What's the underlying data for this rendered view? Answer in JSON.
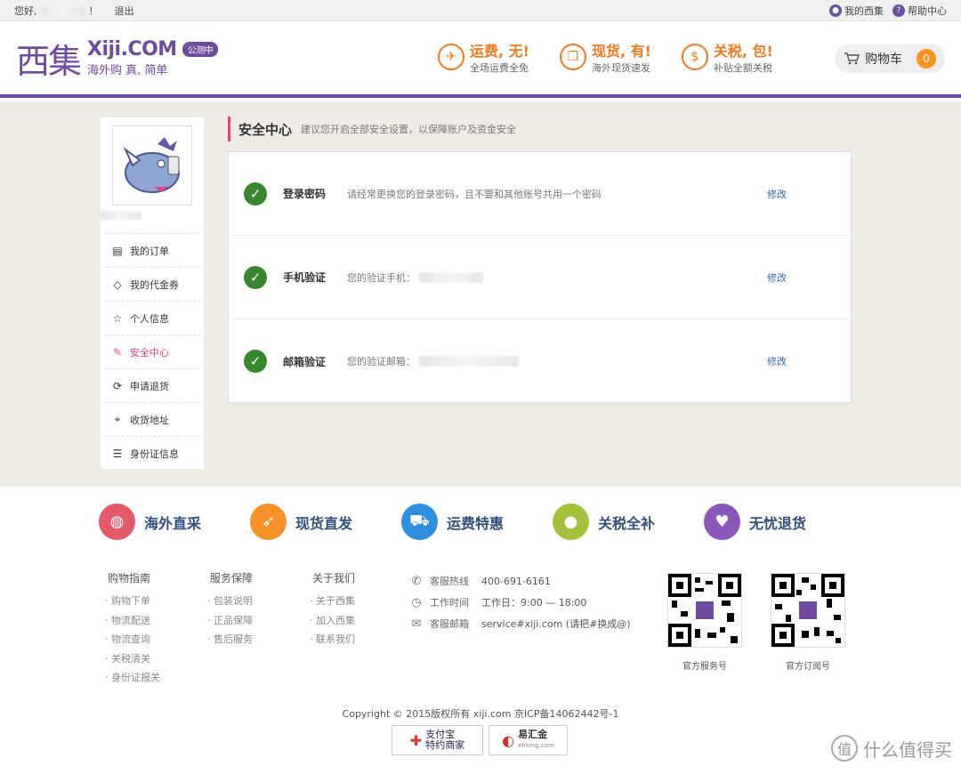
{
  "topbar": {
    "greeting": "您好,",
    "exclaim": "！",
    "logout": "退出",
    "my_xiji": "我的西集",
    "help": "帮助中心"
  },
  "header": {
    "logo_cn": "西集",
    "logo_en": "Xiji.COM",
    "badge": "公测中",
    "slogan": "海外购 真, 简单",
    "promos": [
      {
        "icon": "plane-icon",
        "title": "运费, 无!",
        "sub": "全场运费全免"
      },
      {
        "icon": "gift-icon",
        "title": "现货, 有!",
        "sub": "海外现货速发"
      },
      {
        "icon": "coin-icon",
        "title": "关税, 包!",
        "sub": "补贴全额关税"
      }
    ],
    "cart": {
      "label": "购物车",
      "count": "0"
    }
  },
  "sidebar": {
    "items": [
      {
        "label": "我的订单",
        "icon": "order-icon"
      },
      {
        "label": "我的代金券",
        "icon": "tag-icon"
      },
      {
        "label": "个人信息",
        "icon": "star-icon"
      },
      {
        "label": "安全中心",
        "icon": "edit-icon",
        "active": true
      },
      {
        "label": "申请退货",
        "icon": "refresh-icon"
      },
      {
        "label": "收货地址",
        "icon": "location-icon"
      },
      {
        "label": "身份证信息",
        "icon": "id-icon"
      }
    ]
  },
  "security": {
    "title": "安全中心",
    "desc": "建议您开启全部安全设置，以保障账户及资金安全",
    "rows": [
      {
        "label": "登录密码",
        "desc": "请经常更换您的登录密码，且不要和其他账号共用一个密码",
        "action": "修改"
      },
      {
        "label": "手机验证",
        "desc": "您的验证手机：",
        "action": "修改"
      },
      {
        "label": "邮箱验证",
        "desc": "您的验证邮箱：",
        "action": "修改"
      }
    ]
  },
  "features": [
    {
      "label": "海外直采",
      "color": "#e35a6a",
      "icon": "bag-icon"
    },
    {
      "label": "现货直发",
      "color": "#f5932a",
      "icon": "rocket-icon"
    },
    {
      "label": "运费特惠",
      "color": "#2e8fe0",
      "icon": "truck-icon"
    },
    {
      "label": "关税全补",
      "color": "#a3c23a",
      "icon": "piggy-icon"
    },
    {
      "label": "无忧退货",
      "color": "#8a58b8",
      "icon": "heart-icon"
    }
  ],
  "footer": {
    "columns": [
      {
        "title": "购物指南",
        "links": [
          "· 购物下单",
          "· 物流配送",
          "· 物流查询",
          "· 关税清关",
          "· 身份证报关"
        ]
      },
      {
        "title": "服务保障",
        "links": [
          "· 包装说明",
          "· 正品保障",
          "· 售后服务"
        ]
      },
      {
        "title": "关于我们",
        "links": [
          "· 关于西集",
          "· 加入西集",
          "· 联系我们"
        ]
      }
    ],
    "contact": [
      {
        "label": "客服热线",
        "value": "400-691-6161",
        "icon": "phone-icon"
      },
      {
        "label": "工作时间",
        "value": "工作日：9:00 — 18:00",
        "icon": "clock-icon"
      },
      {
        "label": "客服邮箱",
        "value": "service#xiji.com (请把#换成@)",
        "icon": "mail-icon"
      }
    ],
    "qr": [
      {
        "label": "官方服务号"
      },
      {
        "label": "官方订阅号"
      }
    ],
    "copyright": "Copyright © 2015版权所有 xiji.com 京ICP备14062442号-1",
    "badges": [
      {
        "line1": "支付宝",
        "line2": "特约商家"
      },
      {
        "label": "易汇金",
        "sub": "ehking.com"
      }
    ],
    "watermark": "什么值得买"
  }
}
